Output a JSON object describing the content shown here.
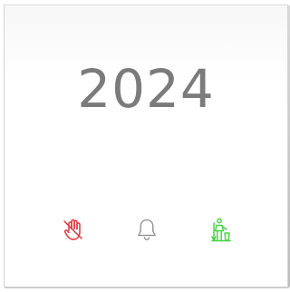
{
  "display": {
    "year": "2024"
  },
  "icons": [
    {
      "name": "do-not-disturb-hand-icon",
      "color": "#e0373d"
    },
    {
      "name": "doorbell-icon",
      "color": "#8a8a8a"
    },
    {
      "name": "clean-room-icon",
      "color": "#3fd63a"
    }
  ],
  "colors": {
    "background": "#ffffff",
    "year_text": "#7b7b7b"
  }
}
